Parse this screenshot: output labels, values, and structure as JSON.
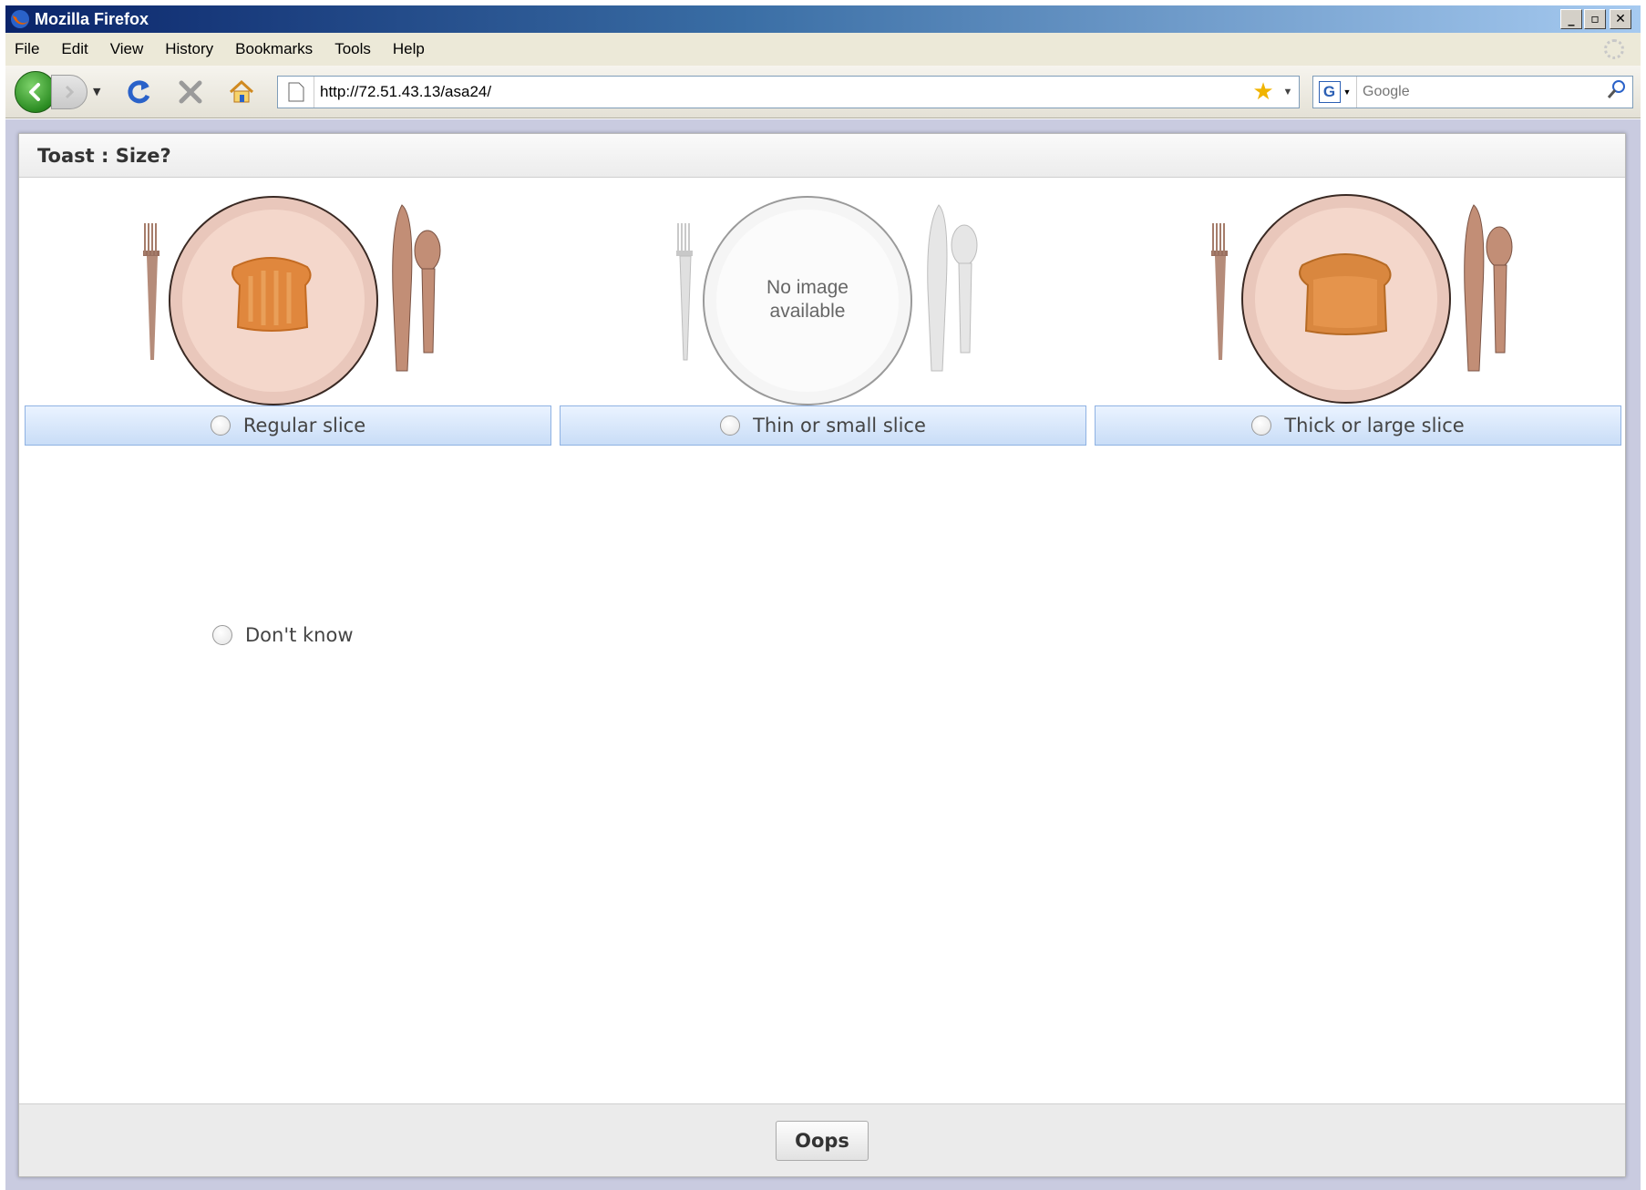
{
  "window": {
    "title": "Mozilla Firefox",
    "controls": [
      "_",
      "▫",
      "✕"
    ]
  },
  "menu": {
    "items": [
      "File",
      "Edit",
      "View",
      "History",
      "Bookmarks",
      "Tools",
      "Help"
    ]
  },
  "navbar": {
    "url": "http://72.51.43.13/asa24/",
    "search_placeholder": "Google"
  },
  "dialog": {
    "title": "Toast : Size?",
    "options": [
      {
        "label": "Regular slice",
        "image": "regular-toast-plate"
      },
      {
        "label": "Thin or small slice",
        "image": "no-image-plate",
        "image_text_1": "No image",
        "image_text_2": "available"
      },
      {
        "label": "Thick or large slice",
        "image": "thick-toast-plate"
      }
    ],
    "dont_know_label": "Don't know",
    "footer_button": "Oops"
  },
  "colors": {
    "option_bar_top": "#eaf3ff",
    "option_bar_bottom": "#c9ddf7",
    "backdrop": "#c9cbe0"
  }
}
